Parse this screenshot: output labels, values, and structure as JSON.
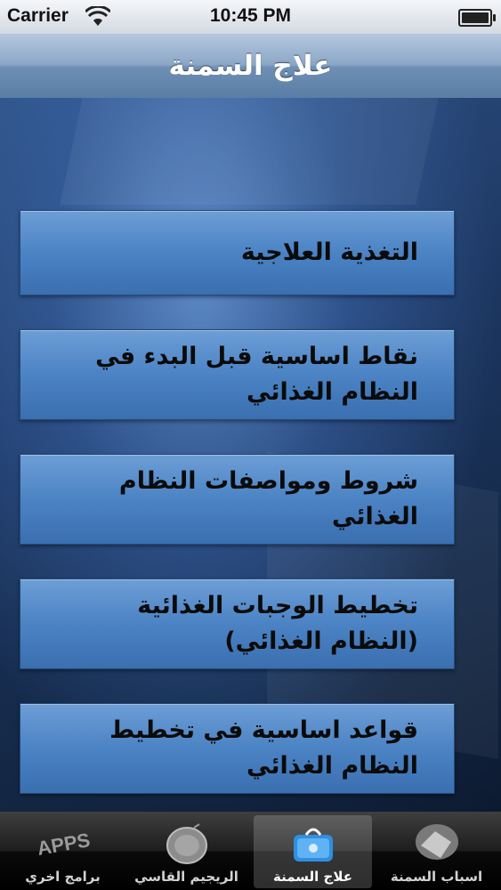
{
  "status_bar": {
    "carrier": "Carrier",
    "time": "10:45 PM"
  },
  "nav": {
    "title": "علاج السمنة"
  },
  "menu": [
    {
      "label": "التغذية العلاجية"
    },
    {
      "label": "نقاط اساسية قبل البدء في النظام الغذائي"
    },
    {
      "label": "شروط ومواصفات النظام الغذائي"
    },
    {
      "label": "تخطيط الوجبات الغذائية (النظام الغذائي)"
    },
    {
      "label": "قواعد اساسية في تخطيط النظام الغذائي"
    }
  ],
  "tabs": [
    {
      "label": "برامج اخري",
      "icon": "apps-icon",
      "icon_text": "APPS"
    },
    {
      "label": "الريجيم القاسي",
      "icon": "plate-icon"
    },
    {
      "label": "علاج السمنة",
      "icon": "scale-icon",
      "active": true
    },
    {
      "label": "اسباب السمنة",
      "icon": "food-bowl-icon"
    }
  ]
}
